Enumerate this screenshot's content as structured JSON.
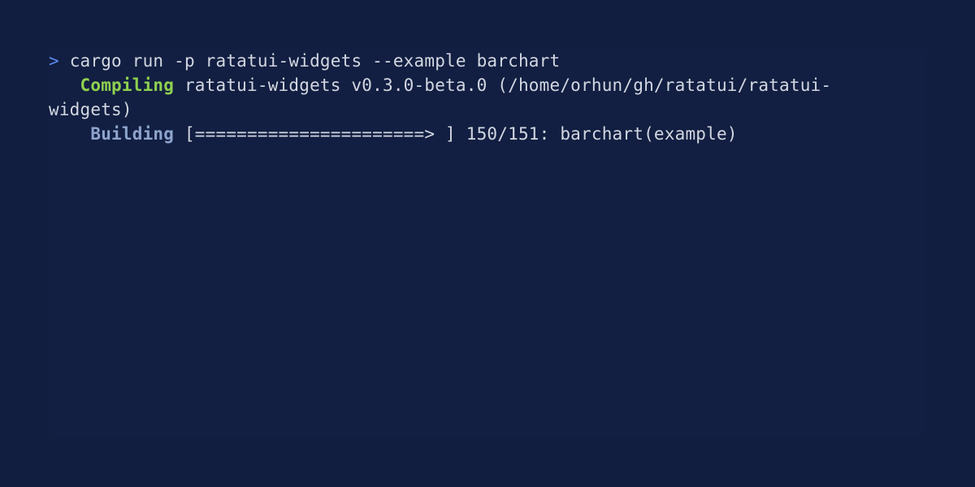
{
  "colors": {
    "background": "#111e40",
    "terminal_bg": "#121f42",
    "prompt": "#5d87e8",
    "compiling": "#8fd14f",
    "building": "#8ea4cd",
    "text": "#d3d7e1"
  },
  "terminal": {
    "prompt_symbol": ">",
    "command": "cargo run -p ratatui-widgets --example barchart",
    "compile_status": "Compiling",
    "compile_target": "ratatui-widgets v0.3.0-beta.0 (/home/orhun/gh/ratatui/ratatui-",
    "compile_target_wrap": "widgets)",
    "build_status": "Building",
    "build_progress_bar": "[======================> ]",
    "build_progress": "150/151: barchart(example)"
  }
}
